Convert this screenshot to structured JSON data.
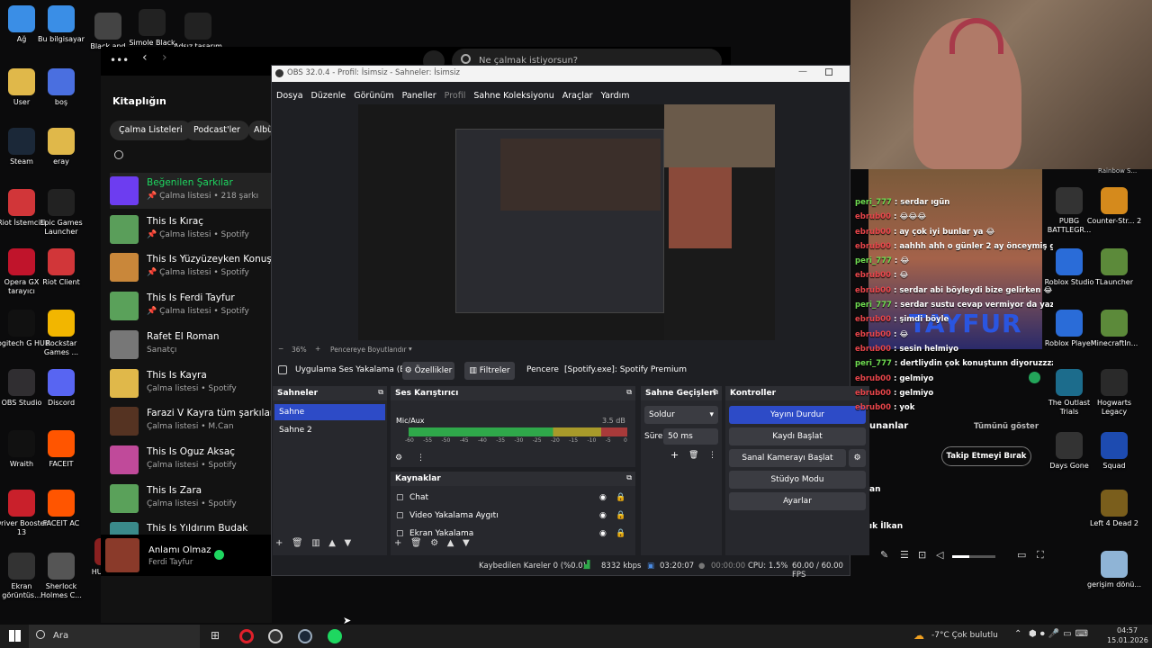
{
  "desktop_icons_left": [
    {
      "label": "Ağ",
      "icon": "network-icon",
      "color": "#3a8ee6"
    },
    {
      "label": "Bu bilgisayar",
      "icon": "computer-icon",
      "color": "#3a8ee6"
    },
    {
      "label": "Black and",
      "icon": "doc-icon",
      "color": "#444"
    },
    {
      "label": "Simole Black",
      "icon": "doc-icon",
      "color": "#222"
    },
    {
      "label": "Adsız tasarım",
      "icon": "doc-icon",
      "color": "#222"
    },
    {
      "label": "User",
      "icon": "folder-icon",
      "color": "#e0b84a"
    },
    {
      "label": "boş",
      "icon": "doc-icon",
      "color": "#4a6fe0"
    },
    {
      "label": "Steam",
      "icon": "steam-icon",
      "color": "#1b2838"
    },
    {
      "label": "eray",
      "icon": "folder-icon",
      "color": "#e0b84a"
    },
    {
      "label": "Riot İstemcisi",
      "icon": "riot-icon",
      "color": "#d13639"
    },
    {
      "label": "Epic Games Launcher",
      "icon": "epic-icon",
      "color": "#222"
    },
    {
      "label": "Opera GX tarayıcı",
      "icon": "opera-icon",
      "color": "#c0142b"
    },
    {
      "label": "Riot Client",
      "icon": "riot-icon",
      "color": "#d13639"
    },
    {
      "label": "Logitech G HUB",
      "icon": "logitech-icon",
      "color": "#111"
    },
    {
      "label": "Rockstar Games ...",
      "icon": "rockstar-icon",
      "color": "#f2b600"
    },
    {
      "label": "OBS Studio",
      "icon": "obs-icon",
      "color": "#302e31"
    },
    {
      "label": "Discord",
      "icon": "discord-icon",
      "color": "#5865f2"
    },
    {
      "label": "Wraith",
      "icon": "wraith-icon",
      "color": "#111"
    },
    {
      "label": "FACEIT",
      "icon": "faceit-icon",
      "color": "#ff5500"
    },
    {
      "label": "Driver Booster 13",
      "icon": "driver-icon",
      "color": "#c9202b"
    },
    {
      "label": "FACEIT AC",
      "icon": "faceit-icon",
      "color": "#ff5500"
    },
    {
      "label": "Ekran görüntüs...",
      "icon": "image-icon",
      "color": "#333"
    },
    {
      "label": "Sherlock Holmes C...",
      "icon": "game-icon",
      "color": "#555"
    },
    {
      "label": "HUDDAM",
      "icon": "image-icon",
      "color": "#8a2020"
    }
  ],
  "desktop_icons_right": [
    {
      "label": "PUBG BATTLEGR...",
      "icon": "pubg-icon",
      "color": "#333"
    },
    {
      "label": "Counter-Str... 2",
      "icon": "cs-icon",
      "color": "#d58a1c"
    },
    {
      "label": "Roblox Studio",
      "icon": "roblox-icon",
      "color": "#2a6cd8"
    },
    {
      "label": "TLauncher",
      "icon": "minecraft-icon",
      "color": "#5c8a3a"
    },
    {
      "label": "Roblox Player",
      "icon": "roblox-icon",
      "color": "#2a6cd8"
    },
    {
      "label": "MinecraftIn...",
      "icon": "minecraft-icon",
      "color": "#5c8a3a"
    },
    {
      "label": "The Outlast Trials",
      "icon": "game-icon",
      "color": "#1c6c8c"
    },
    {
      "label": "Hogwarts Legacy",
      "icon": "game-icon",
      "color": "#2a2a2a"
    },
    {
      "label": "Days Gone",
      "icon": "game-icon",
      "color": "#333"
    },
    {
      "label": "Squad",
      "icon": "game-icon",
      "color": "#1d4bb0"
    },
    {
      "label": "Left 4 Dead 2",
      "icon": "game-icon",
      "color": "#7a5e1c"
    },
    {
      "label": "gerişim dönü...",
      "icon": "recycle-bin-icon",
      "color": "#8fb4d6"
    }
  ],
  "spotify": {
    "search_placeholder": "Ne çalmak istiyorsun?",
    "library_title": "Kitaplığın",
    "filters": [
      "Çalma Listeleri",
      "Podcast'ler",
      "Albü"
    ],
    "items": [
      {
        "title": "Beğenilen Şarkılar",
        "sub": "Çalma listesi • 218 şarkı",
        "color": "#6d3df0",
        "pinned": true
      },
      {
        "title": "This Is Kıraç",
        "sub": "Çalma listesi • Spotify",
        "color": "#5a9e5a",
        "pinned": true
      },
      {
        "title": "This Is Yüzyüzeyken Konuşuru",
        "sub": "Çalma listesi • Spotify",
        "color": "#c9873a",
        "pinned": true
      },
      {
        "title": "This Is Ferdi Tayfur",
        "sub": "Çalma listesi • Spotify",
        "color": "#5aa15a",
        "pinned": true
      },
      {
        "title": "Rafet El Roman",
        "sub": "Sanatçı",
        "color": "#777",
        "pinned": false
      },
      {
        "title": "This Is Kayra",
        "sub": "Çalma listesi • Spotify",
        "color": "#e0b84a",
        "pinned": false
      },
      {
        "title": "Farazi V Kayra tüm şarkılar",
        "sub": "Çalma listesi • M.Can",
        "color": "#553322",
        "pinned": false
      },
      {
        "title": "This Is Oguz Aksaç",
        "sub": "Çalma listesi • Spotify",
        "color": "#c04a9a",
        "pinned": false
      },
      {
        "title": "This Is Zara",
        "sub": "Çalma listesi • Spotify",
        "color": "#5aa15a",
        "pinned": false
      },
      {
        "title": "This Is Yıldırım Budak",
        "sub": "",
        "color": "#3a8a8a",
        "pinned": false
      }
    ],
    "now_playing": {
      "title": "Anlamı Olmaz",
      "artist": "Ferdi Tayfur"
    }
  },
  "obs": {
    "title": "OBS 32.0.4 - Profil: İsimsiz - Sahneler: İsimsiz",
    "menu": [
      "Dosya",
      "Düzenle",
      "Görünüm",
      "Paneller",
      "Profil",
      "Sahne Koleksiyonu",
      "Araçlar",
      "Yardım"
    ],
    "zoom": "36%",
    "fit_label": "Pencereye Boyutlandır",
    "source_bar": {
      "source": "Uygulama Ses Yakalama (Bi",
      "properties": "Özellikler",
      "filters": "Filtreler",
      "window_label": "Pencere",
      "window_value": "[Spotify.exe]: Spotify Premium"
    },
    "scenes": {
      "title": "Sahneler",
      "items": [
        "Sahne",
        "Sahne 2"
      ]
    },
    "mixer": {
      "title": "Ses Karıştırıcı",
      "track": "Mic/Aux",
      "db": "3.5 dB",
      "ticks": [
        "-60",
        "-55",
        "-50",
        "-45",
        "-40",
        "-35",
        "-30",
        "-25",
        "-20",
        "-15",
        "-10",
        "-5",
        "0"
      ]
    },
    "sources": {
      "title": "Kaynaklar",
      "items": [
        "Chat",
        "Video Yakalama Aygıtı",
        "Ekran Yakalama"
      ]
    },
    "transitions": {
      "title": "Sahne Geçişleri",
      "type": "Soldur",
      "duration_label": "Süre",
      "duration": "50 ms"
    },
    "controls": {
      "title": "Kontroller",
      "buttons": [
        "Yayını Durdur",
        "Kaydı Başlat",
        "Sanal Kamerayı Başlat",
        "Stüdyo Modu",
        "Ayarlar"
      ]
    },
    "status": {
      "dropped": "Kaybedilen Kareler 0 (%0.0)",
      "bitrate": "8332 kbps",
      "live_time": "03:20:07",
      "rec_time": "00:00:00",
      "cpu": "CPU: 1.5%",
      "fps": "60.00 / 60.00 FPS"
    }
  },
  "chat": {
    "lines": [
      {
        "user": "peri_777",
        "msg": ": serdar ıgün",
        "color": "green"
      },
      {
        "user": "ebrub00",
        "msg": ": 😂😂😂",
        "color": "red"
      },
      {
        "user": "ebrub00",
        "msg": ": ay çok iyi bunlar ya 😂",
        "color": "red"
      },
      {
        "user": "ebrub00",
        "msg": ": aahhh ahh o günler 2 ay önceymiş gibi hatırlıyorum",
        "color": "red"
      },
      {
        "user": "peri_777",
        "msg": ": 😂",
        "color": "green"
      },
      {
        "user": "ebrub00",
        "msg": ": 😂",
        "color": "red"
      },
      {
        "user": "ebrub00",
        "msg": ": serdar abi böyleydi bize gelirken 😂",
        "color": "red"
      },
      {
        "user": "peri_777",
        "msg": ": serdar sustu cevap vermiyor da yazılanlara",
        "color": "green"
      },
      {
        "user": "ebrub00",
        "msg": ": şimdi böyle",
        "color": "red"
      },
      {
        "user": "ebrub00",
        "msg": ": 😂",
        "color": "red"
      },
      {
        "user": "ebrub00",
        "msg": ": sesin helmiyo",
        "color": "red"
      },
      {
        "user": "peri_777",
        "msg": ": dertliydin çok konuştunn diyoruzzzzz",
        "color": "green"
      },
      {
        "user": "ebrub00",
        "msg": ": gelmiyo",
        "color": "red"
      },
      {
        "user": "ebrub00",
        "msg": ": gelmiyo",
        "color": "red"
      },
      {
        "user": "ebrub00",
        "msg": ": yok",
        "color": "red"
      }
    ],
    "show_all": "Tümünü göster",
    "unfollow": "Takip Etmeyi Bırak",
    "partial_1": "unanlar",
    "partial_2": "an",
    "partial_3": "ık İlkan",
    "overlay_name": "TAYFUR",
    "top_right_label": "Rainbow S..."
  },
  "taskbar": {
    "search": "Ara",
    "weather": "-7°C  Çok bulutlu",
    "time": "04:57",
    "date": "15.01.2026"
  }
}
